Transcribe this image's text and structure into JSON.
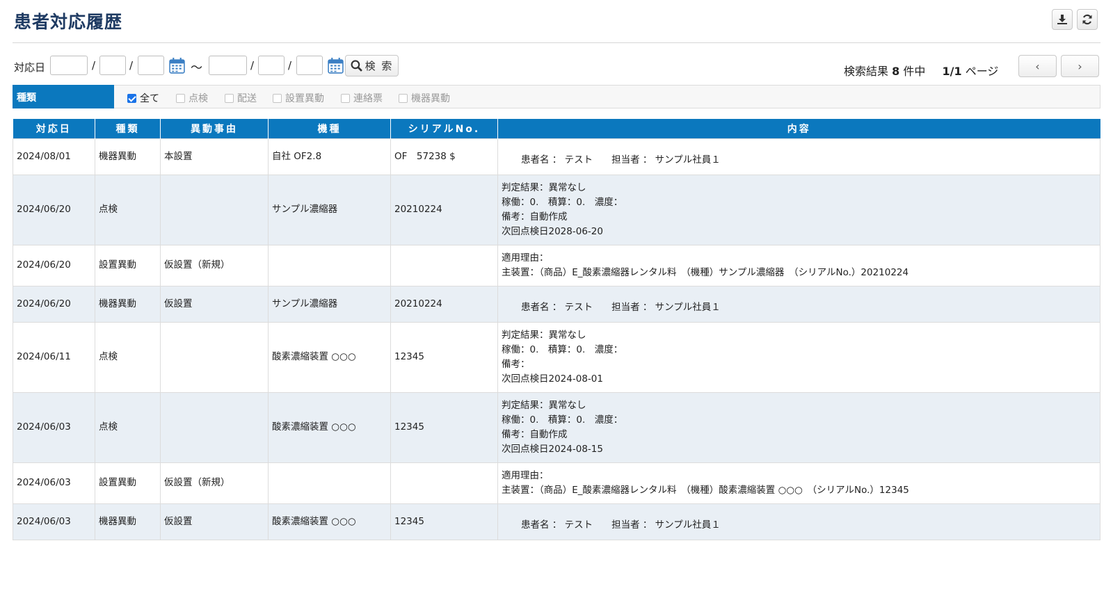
{
  "header": {
    "title": "患者対応履歴"
  },
  "search": {
    "date_label": "対応日",
    "slash": "/",
    "tilde": "〜",
    "search_button": "検 索"
  },
  "result": {
    "prefix": "検索結果",
    "count": "8",
    "suffix": "件中",
    "page": "1/1",
    "page_suffix": "ページ"
  },
  "filter": {
    "label": "種類",
    "options": [
      {
        "label": "全て",
        "checked": true
      },
      {
        "label": "点検",
        "checked": false
      },
      {
        "label": "配送",
        "checked": false
      },
      {
        "label": "設置異動",
        "checked": false
      },
      {
        "label": "連絡票",
        "checked": false
      },
      {
        "label": "機器異動",
        "checked": false
      }
    ]
  },
  "table": {
    "columns": [
      "対応日",
      "種類",
      "異動事由",
      "機種",
      "シリアルNo.",
      "内容"
    ],
    "rows": [
      {
        "date": "2024/08/01",
        "type": "機器異動",
        "reason": "本設置",
        "model": "自社 OF2.8",
        "serial": "OF　57238 $",
        "content": [
          "患者名 ： テスト　　担当者 ： サンプル社員１"
        ]
      },
      {
        "date": "2024/06/20",
        "type": "点検",
        "reason": "",
        "model": "サンプル濃縮器",
        "serial": "20210224",
        "content": [
          "判定結果：異常なし",
          "稼働：0.　積算：0.　濃度：",
          "備考：自動作成",
          "次回点検日2028-06-20"
        ]
      },
      {
        "date": "2024/06/20",
        "type": "設置異動",
        "reason": "仮設置（新規）",
        "model": "",
        "serial": "",
        "content": [
          "適用理由：",
          "主装置：（商品）E_酸素濃縮器レンタル料　（機種）サンプル濃縮器　（シリアルNo.）20210224"
        ]
      },
      {
        "date": "2024/06/20",
        "type": "機器異動",
        "reason": "仮設置",
        "model": "サンプル濃縮器",
        "serial": "20210224",
        "content": [
          "患者名 ： テスト　　担当者 ： サンプル社員１"
        ]
      },
      {
        "date": "2024/06/11",
        "type": "点検",
        "reason": "",
        "model": "酸素濃縮装置 ○○○",
        "serial": "12345",
        "content": [
          "判定結果：異常なし",
          "稼働：0.　積算：0.　濃度：",
          "備考：",
          "次回点検日2024-08-01"
        ]
      },
      {
        "date": "2024/06/03",
        "type": "点検",
        "reason": "",
        "model": "酸素濃縮装置 ○○○",
        "serial": "12345",
        "content": [
          "判定結果：異常なし",
          "稼働：0.　積算：0.　濃度：",
          "備考：自動作成",
          "次回点検日2024-08-15"
        ]
      },
      {
        "date": "2024/06/03",
        "type": "設置異動",
        "reason": "仮設置（新規）",
        "model": "",
        "serial": "",
        "content": [
          "適用理由：",
          "主装置：（商品）E_酸素濃縮器レンタル料　（機種）酸素濃縮装置 ○○○　（シリアルNo.）12345"
        ]
      },
      {
        "date": "2024/06/03",
        "type": "機器異動",
        "reason": "仮設置",
        "model": "酸素濃縮装置 ○○○",
        "serial": "12345",
        "content": [
          "患者名 ： テスト　　担当者 ： サンプル社員１"
        ]
      }
    ]
  },
  "icons": {
    "download": "download-icon",
    "refresh": "refresh-icon",
    "calendar": "calendar-icon",
    "search": "search-icon",
    "prev": "‹",
    "next": "›"
  },
  "colors": {
    "accent": "#0b78be",
    "title": "#1f3b63",
    "row_alt": "#e9eff5"
  }
}
